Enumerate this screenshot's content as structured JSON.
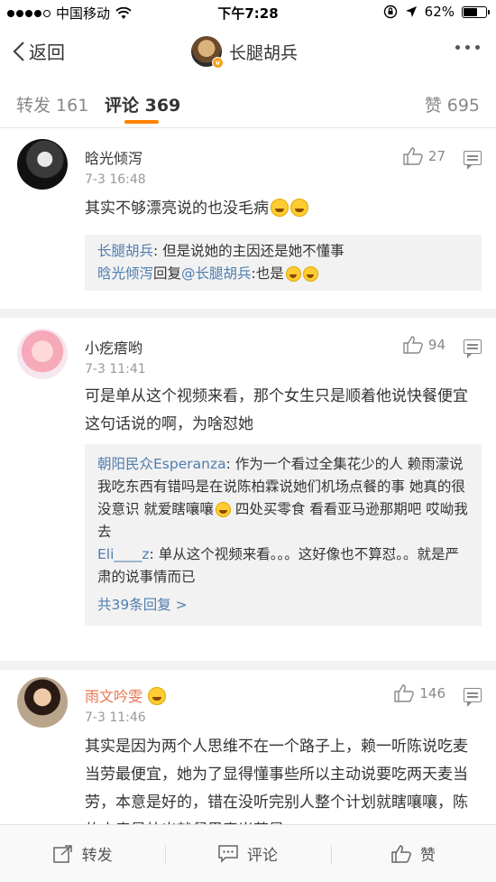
{
  "status_bar": {
    "carrier": "中国移动",
    "time": "下午7:28",
    "battery": "62%",
    "battery_level": 0.62
  },
  "nav": {
    "back_label": "返回",
    "title": "长腿胡兵"
  },
  "tabs": [
    {
      "label": "转发 161"
    },
    {
      "label": "评论 369"
    },
    {
      "label": "赞 695"
    }
  ],
  "comments": [
    {
      "name": "晗光倾泻",
      "time": "7-3 16:48",
      "likes": "27",
      "text": "其实不够漂亮说的也没毛病",
      "replies": [
        {
          "user": "长腿胡兵",
          "text": ": 但是说她的主因还是她不懂事"
        },
        {
          "user": "晗光倾泻",
          "mid": "回复",
          "target": "@长腿胡兵",
          "text": ":也是"
        }
      ]
    },
    {
      "name": "小疙瘩哟",
      "time": "7-3 11:41",
      "likes": "94",
      "text": "可是单从这个视频来看，那个女生只是顺着他说快餐便宜这句话说的啊，为啥怼她",
      "replies": [
        {
          "user": "朝阳民众Esperanza",
          "text": ": 作为一个看过全集花少的人 赖雨濛说我吃东西有错吗是在说陈柏霖说她们机场点餐的事 她真的很没意识 就爱瞎嚷嚷",
          "text2": " 四处买零食 看看亚马逊那期吧 哎呦我去"
        },
        {
          "user": "Eli____z",
          "text": ": 单从这个视频来看。。。这好像也不算怼。。就是严肃的说事情而已"
        }
      ],
      "more_replies": "共39条回复 >"
    },
    {
      "name": "雨文吟雯",
      "time": "7-3 11:46",
      "likes": "146",
      "text": "其实是因为两个人思维不在一个路子上，赖一听陈说吃麦当劳最便宜，她为了显得懂事些所以主动说要吃两天麦当劳，本意是好的，错在没听完别人整个计划就瞎嚷嚷，陈的本意是外出就餐里麦当劳是"
    }
  ],
  "toolbar": {
    "repost": "转发",
    "comment": "评论",
    "like": "赞"
  }
}
